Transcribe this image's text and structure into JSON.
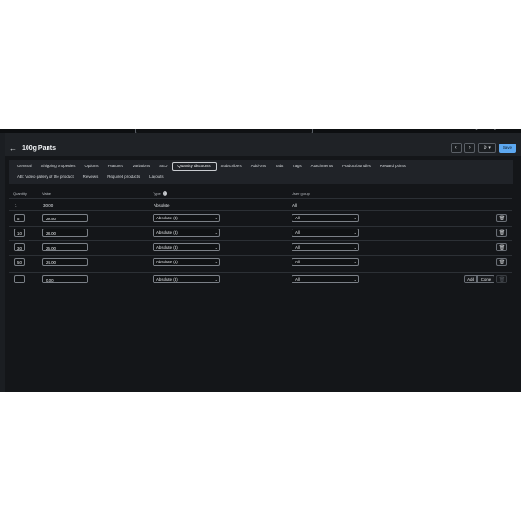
{
  "product_title": "100g Pants",
  "header_buttons": {
    "prev": "‹",
    "next": "›",
    "settings": "⚙ ▾",
    "save": "Save"
  },
  "tabs_row1": [
    "General",
    "Shipping properties",
    "Options",
    "Features",
    "Variations",
    "SEO",
    "Quantity discounts",
    "Subscribers",
    "Add-ons",
    "Tabs",
    "Tags",
    "Attachments",
    "Product bundles",
    "Reward points"
  ],
  "tabs_row2": [
    "AB: Video gallery of the product",
    "Reviews",
    "Required products",
    "Layouts"
  ],
  "active_tab": "Quantity discounts",
  "table": {
    "headers": {
      "quantity": "Quantity",
      "value": "Value",
      "type": "Type",
      "user_group": "User group"
    },
    "base_row": {
      "quantity": "1",
      "value": "30.00",
      "type": "Absolute",
      "user_group": "All"
    },
    "rows": [
      {
        "quantity": "5",
        "value": "29.50",
        "type": "Absolute ($)",
        "user_group": "All"
      },
      {
        "quantity": "10",
        "value": "28.00",
        "type": "Absolute ($)",
        "user_group": "All"
      },
      {
        "quantity": "30",
        "value": "26.00",
        "type": "Absolute ($)",
        "user_group": "All"
      },
      {
        "quantity": "50",
        "value": "24.00",
        "type": "Absolute ($)",
        "user_group": "All"
      }
    ],
    "new_row": {
      "quantity": "",
      "value": "0.00",
      "type": "Absolute ($)",
      "user_group": "All"
    },
    "add_label": "Add",
    "clone_label": "Clone"
  },
  "icons": {
    "back": "arrow-left-icon",
    "trash": "trash-icon",
    "help": "help-circle-icon",
    "gear": "gear-icon"
  }
}
